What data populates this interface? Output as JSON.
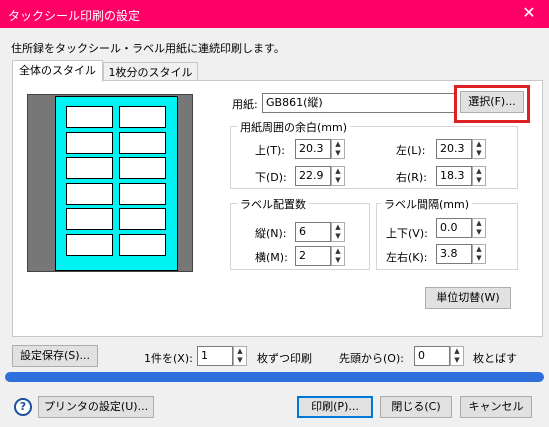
{
  "window": {
    "title": "タックシール印刷の設定",
    "close_glyph": "✕"
  },
  "description": "住所録をタックシール・ラベル用紙に連続印刷します。",
  "tabs": [
    {
      "label": "全体のスタイル",
      "active": true
    },
    {
      "label": "1枚分のスタイル",
      "active": false
    }
  ],
  "paper": {
    "label": "用紙:",
    "value": "GB861(縦)",
    "select_button": "選択(F)..."
  },
  "margin_group": {
    "title": "用紙周囲の余白(mm)",
    "top": {
      "label": "上(T):",
      "value": "20.3"
    },
    "left": {
      "label": "左(L):",
      "value": "20.3"
    },
    "bottom": {
      "label": "下(D):",
      "value": "22.9"
    },
    "right": {
      "label": "右(R):",
      "value": "18.3"
    }
  },
  "layout_group": {
    "title": "ラベル配置数",
    "rows": {
      "label": "縦(N):",
      "value": "6"
    },
    "cols": {
      "label": "横(M):",
      "value": "2"
    }
  },
  "spacing_group": {
    "title": "ラベル間隔(mm)",
    "vertical": {
      "label": "上下(V):",
      "value": "0.0"
    },
    "horizontal": {
      "label": "左右(K):",
      "value": "3.8"
    }
  },
  "unit_toggle_button": "単位切替(W)",
  "bottom_row": {
    "save_button": "設定保存(S)...",
    "per_item_label": "1件を(X):",
    "per_item_value": "1",
    "per_item_suffix": "枚ずつ印刷",
    "skip_label": "先頭から(O):",
    "skip_value": "0",
    "skip_suffix": "枚とばす"
  },
  "footer": {
    "help_icon_glyph": "?",
    "printer_settings_button": "プリンタの設定(U)...",
    "print_button": "印刷(P)...",
    "close_button": "閉じる(C)",
    "cancel_button": "キャンセル"
  },
  "colors": {
    "title_bar": "#ff0066",
    "preview_sheet": "#00f2f2",
    "highlight": "#e02020",
    "progress": "#2f6fdc"
  },
  "preview_grid": {
    "rows": 6,
    "cols": 2
  }
}
